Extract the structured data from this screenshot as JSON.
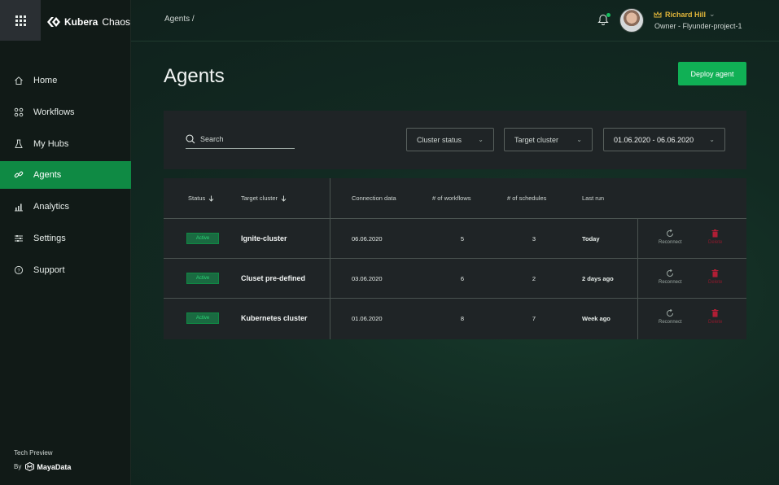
{
  "app": {
    "logo_bold": "Kubera",
    "logo_thin": "Chaos"
  },
  "sidebar": {
    "items": [
      {
        "label": "Home",
        "icon": "home-icon",
        "active": false
      },
      {
        "label": "Workflows",
        "icon": "workflows-icon",
        "active": false
      },
      {
        "label": "My Hubs",
        "icon": "flask-icon",
        "active": false
      },
      {
        "label": "Agents",
        "icon": "link-icon",
        "active": true
      },
      {
        "label": "Analytics",
        "icon": "bar-chart-icon",
        "active": false
      },
      {
        "label": "Settings",
        "icon": "sliders-icon",
        "active": false
      },
      {
        "label": "Support",
        "icon": "help-icon",
        "active": false
      }
    ],
    "footer_preview": "Tech Preview",
    "footer_by": "By",
    "footer_brand": "MayaData"
  },
  "header": {
    "breadcrumb": "Agents  /",
    "user_name": "Richard Hill",
    "user_role": "Owner - Flyunder-project-1"
  },
  "main": {
    "title": "Agents",
    "deploy_label": "Deploy agent"
  },
  "filters": {
    "search_placeholder": "Search",
    "cluster_status": "Cluster status",
    "target_cluster": "Target cluster",
    "date_range": "01.06.2020 - 06.06.2020"
  },
  "table": {
    "headers": {
      "status": "Status",
      "target": "Target cluster",
      "connection": "Connection data",
      "workflows": "# of workflows",
      "schedules": "# of schedules",
      "last_run": "Last run"
    },
    "rows": [
      {
        "status": "Active",
        "name": "Ignite-cluster",
        "date": "06.06.2020",
        "workflows": "5",
        "schedules": "3",
        "last_run": "Today",
        "reconnect": "Reconnect",
        "delete": "Delete"
      },
      {
        "status": "Active",
        "name": "Cluset pre-defined",
        "date": "03.06.2020",
        "workflows": "6",
        "schedules": "2",
        "last_run": "2 days ago",
        "reconnect": "Reconnect",
        "delete": "Delete"
      },
      {
        "status": "Active",
        "name": "Kubernetes cluster",
        "date": "01.06.2020",
        "workflows": "8",
        "schedules": "7",
        "last_run": "Week ago",
        "reconnect": "Reconnect",
        "delete": "Delete"
      }
    ]
  },
  "colors": {
    "accent": "#10b055",
    "active_nav": "#0f8a44",
    "user_name": "#e0b53a",
    "delete": "#8b1a2c"
  }
}
